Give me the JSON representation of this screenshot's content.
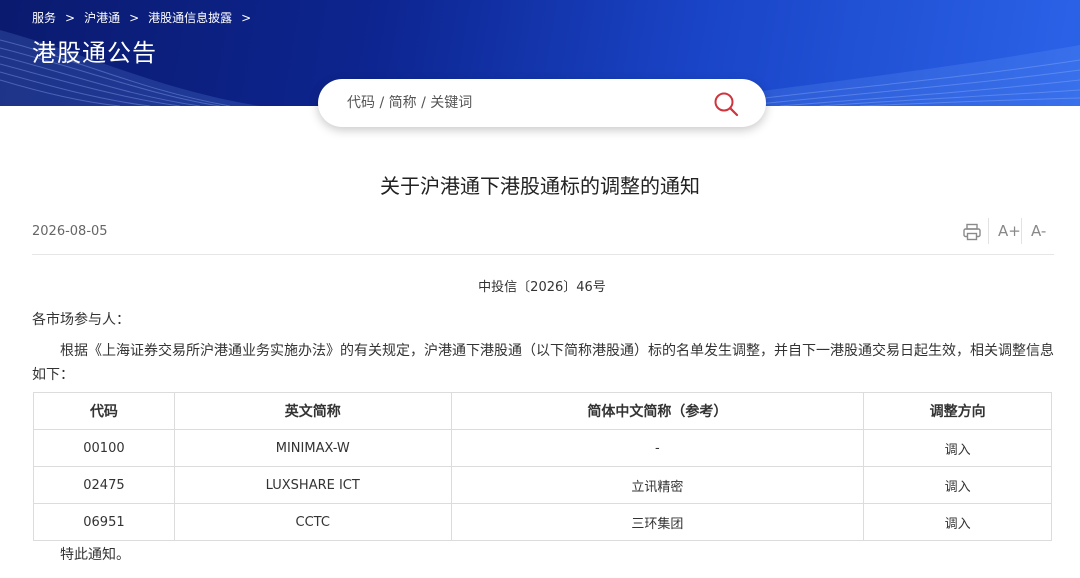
{
  "breadcrumb": {
    "items": [
      "服务",
      "沪港通",
      "港股通信息披露"
    ],
    "separator": ">"
  },
  "banner": {
    "title": "港股通公告",
    "colors": {
      "dark": "#0a1a6e",
      "light": "#2b63e8"
    }
  },
  "search": {
    "placeholder": "代码 / 简称 / 关键词",
    "value": "",
    "icon": "search-icon",
    "icon_color": "#d0343d"
  },
  "article": {
    "title": "关于沪港通下港股通标的调整的通知",
    "date": "2026-08-05",
    "tools": {
      "print_icon": "printer-icon",
      "font_increase": "A+",
      "font_decrease": "A-"
    },
    "doc_number": "中投信〔2026〕46号",
    "salutation": "各市场参与人：",
    "body": "根据《上海证券交易所沪港通业务实施办法》的有关规定，沪港通下港股通（以下简称港股通）标的名单发生调整，并自下一港股通交易日起生效，相关调整信息如下：",
    "closing": "特此通知。"
  },
  "table": {
    "headers": [
      "代码",
      "英文简称",
      "简体中文简称（参考）",
      "调整方向"
    ],
    "rows": [
      [
        "00100",
        "MINIMAX-W",
        "-",
        "调入"
      ],
      [
        "02475",
        "LUXSHARE ICT",
        "立讯精密",
        "调入"
      ],
      [
        "06951",
        "CCTC",
        "三环集团",
        "调入"
      ]
    ]
  }
}
